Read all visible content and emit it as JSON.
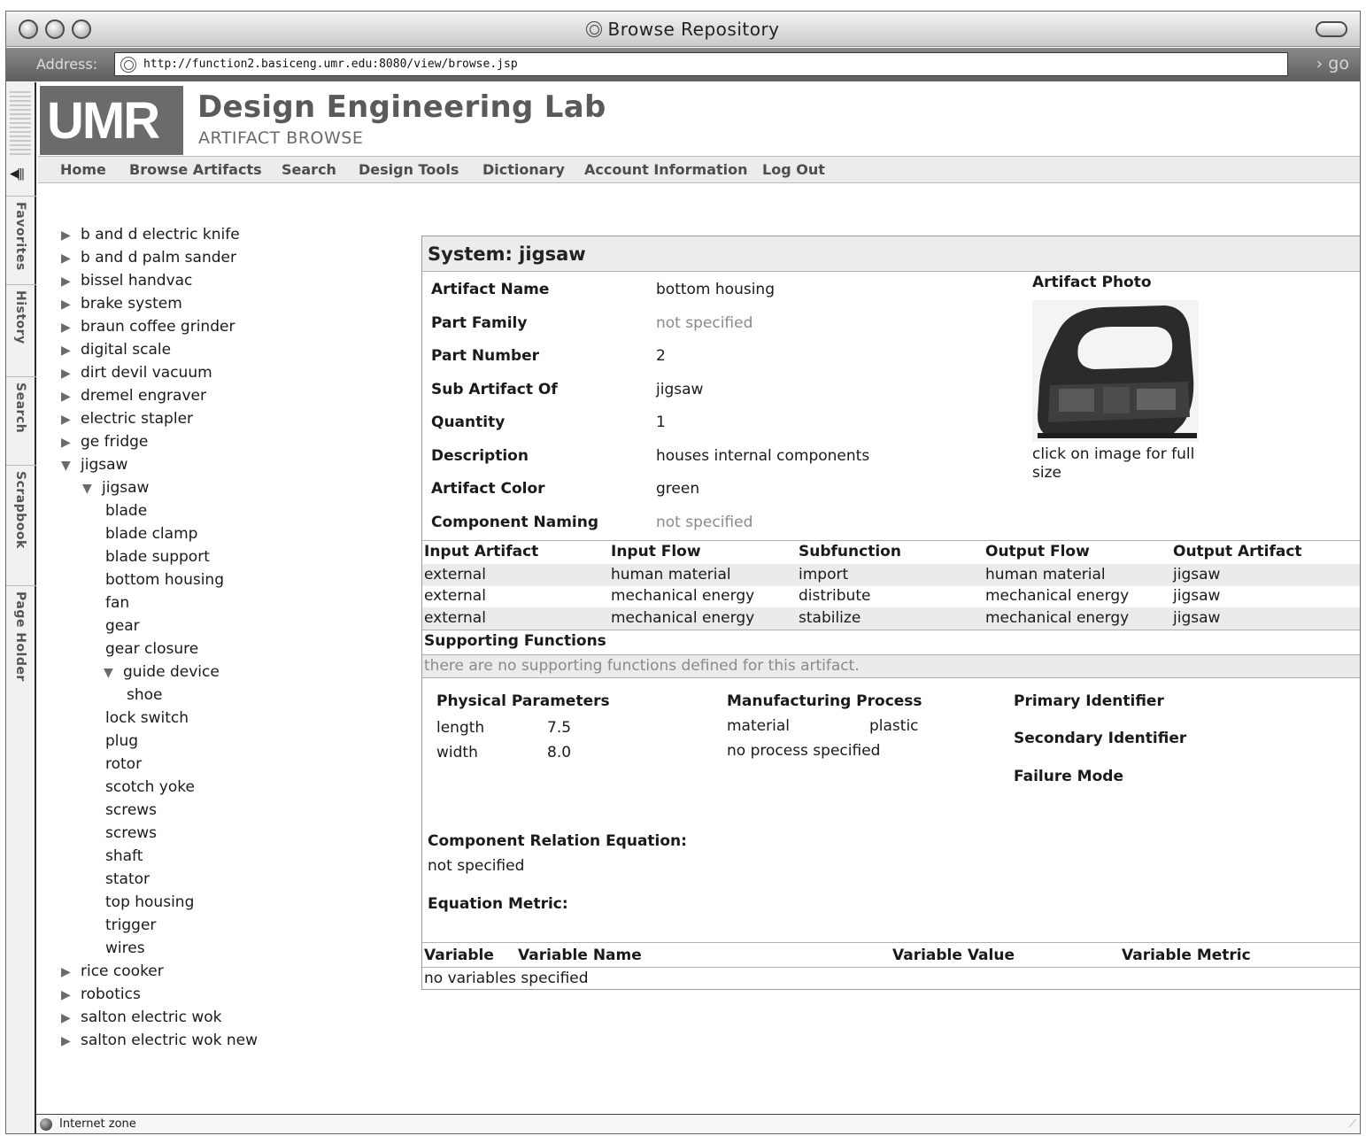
{
  "window": {
    "title": "Browse Repository",
    "address_label": "Address:",
    "url": "http://function2.basiceng.umr.edu:8080/view/browse.jsp",
    "go_label": "› go",
    "status": "Internet zone"
  },
  "drawer_tabs": [
    "Favorites",
    "History",
    "Search",
    "Scrapbook",
    "Page Holder"
  ],
  "site": {
    "logo": "UMR",
    "title": "Design Engineering Lab",
    "subtitle": "ARTIFACT BROWSE"
  },
  "nav": [
    "Home",
    "Browse Artifacts",
    "Search",
    "Design Tools",
    "Dictionary",
    "Account Information",
    "Log Out"
  ],
  "tree": [
    {
      "label": "b and d electric knife",
      "level": 0,
      "state": "collapsed"
    },
    {
      "label": "b and d palm sander",
      "level": 0,
      "state": "collapsed"
    },
    {
      "label": "bissel handvac",
      "level": 0,
      "state": "collapsed"
    },
    {
      "label": "brake system",
      "level": 0,
      "state": "collapsed"
    },
    {
      "label": "braun coffee grinder",
      "level": 0,
      "state": "collapsed"
    },
    {
      "label": "digital scale",
      "level": 0,
      "state": "collapsed"
    },
    {
      "label": "dirt devil vacuum",
      "level": 0,
      "state": "collapsed"
    },
    {
      "label": "dremel engraver",
      "level": 0,
      "state": "collapsed"
    },
    {
      "label": "electric stapler",
      "level": 0,
      "state": "collapsed"
    },
    {
      "label": "ge fridge",
      "level": 0,
      "state": "collapsed"
    },
    {
      "label": "jigsaw",
      "level": 0,
      "state": "expanded"
    },
    {
      "label": "jigsaw",
      "level": 1,
      "state": "expanded"
    },
    {
      "label": "blade",
      "level": 2,
      "state": "leaf"
    },
    {
      "label": "blade clamp",
      "level": 2,
      "state": "leaf"
    },
    {
      "label": "blade support",
      "level": 2,
      "state": "leaf"
    },
    {
      "label": "bottom housing",
      "level": 2,
      "state": "leaf"
    },
    {
      "label": "fan",
      "level": 2,
      "state": "leaf"
    },
    {
      "label": "gear",
      "level": 2,
      "state": "leaf"
    },
    {
      "label": "gear closure",
      "level": 2,
      "state": "leaf"
    },
    {
      "label": "guide device",
      "level": 2,
      "state": "expanded"
    },
    {
      "label": "shoe",
      "level": 3,
      "state": "leaf"
    },
    {
      "label": "lock switch",
      "level": 2,
      "state": "leaf"
    },
    {
      "label": "plug",
      "level": 2,
      "state": "leaf"
    },
    {
      "label": "rotor",
      "level": 2,
      "state": "leaf"
    },
    {
      "label": "scotch yoke",
      "level": 2,
      "state": "leaf"
    },
    {
      "label": "screws",
      "level": 2,
      "state": "leaf"
    },
    {
      "label": "screws",
      "level": 2,
      "state": "leaf"
    },
    {
      "label": "shaft",
      "level": 2,
      "state": "leaf"
    },
    {
      "label": "stator",
      "level": 2,
      "state": "leaf"
    },
    {
      "label": "top housing",
      "level": 2,
      "state": "leaf"
    },
    {
      "label": "trigger",
      "level": 2,
      "state": "leaf"
    },
    {
      "label": "wires",
      "level": 2,
      "state": "leaf"
    },
    {
      "label": "rice cooker",
      "level": 0,
      "state": "collapsed"
    },
    {
      "label": "robotics",
      "level": 0,
      "state": "collapsed"
    },
    {
      "label": "salton electric wok",
      "level": 0,
      "state": "collapsed"
    },
    {
      "label": "salton electric wok new",
      "level": 0,
      "state": "collapsed"
    }
  ],
  "system": {
    "heading": "System: jigsaw",
    "properties": [
      {
        "label": "Artifact Name",
        "value": "bottom housing",
        "muted": false
      },
      {
        "label": "Part Family",
        "value": "not specified",
        "muted": true
      },
      {
        "label": "Part Number",
        "value": "2",
        "muted": false
      },
      {
        "label": "Sub Artifact Of",
        "value": "jigsaw",
        "muted": false
      },
      {
        "label": "Quantity",
        "value": "1",
        "muted": false
      },
      {
        "label": "Description",
        "value": "houses internal components",
        "muted": false
      },
      {
        "label": "Artifact Color",
        "value": "green",
        "muted": false
      },
      {
        "label": "Component Naming",
        "value": "not specified",
        "muted": true
      }
    ],
    "photo_title": "Artifact Photo",
    "photo_caption": "click on image for full size",
    "flow_headers": [
      "Input Artifact",
      "Input Flow",
      "Subfunction",
      "Output Flow",
      "Output Artifact"
    ],
    "flow_rows": [
      [
        "external",
        "human material",
        "import",
        "human material",
        "jigsaw"
      ],
      [
        "external",
        "mechanical energy",
        "distribute",
        "mechanical energy",
        "jigsaw"
      ],
      [
        "external",
        "mechanical energy",
        "stabilize",
        "mechanical energy",
        "jigsaw"
      ]
    ],
    "supporting_title": "Supporting Functions",
    "supporting_text": "there are no supporting functions defined for this artifact.",
    "physical": {
      "title": "Physical Parameters",
      "rows": [
        [
          "length",
          "7.5"
        ],
        [
          "width",
          "8.0"
        ]
      ]
    },
    "manufacturing": {
      "title": "Manufacturing Process",
      "material_label": "material",
      "material_value": "plastic",
      "process": "no process specified"
    },
    "identifiers": [
      "Primary Identifier",
      "Secondary Identifier",
      "Failure Mode"
    ],
    "relation": {
      "title": "Component Relation Equation:",
      "value": "not specified",
      "metric_title": "Equation Metric:"
    },
    "variable_headers": [
      "Variable",
      "Variable Name",
      "Variable Value",
      "Variable Metric"
    ],
    "variable_empty": "no variables specified"
  }
}
